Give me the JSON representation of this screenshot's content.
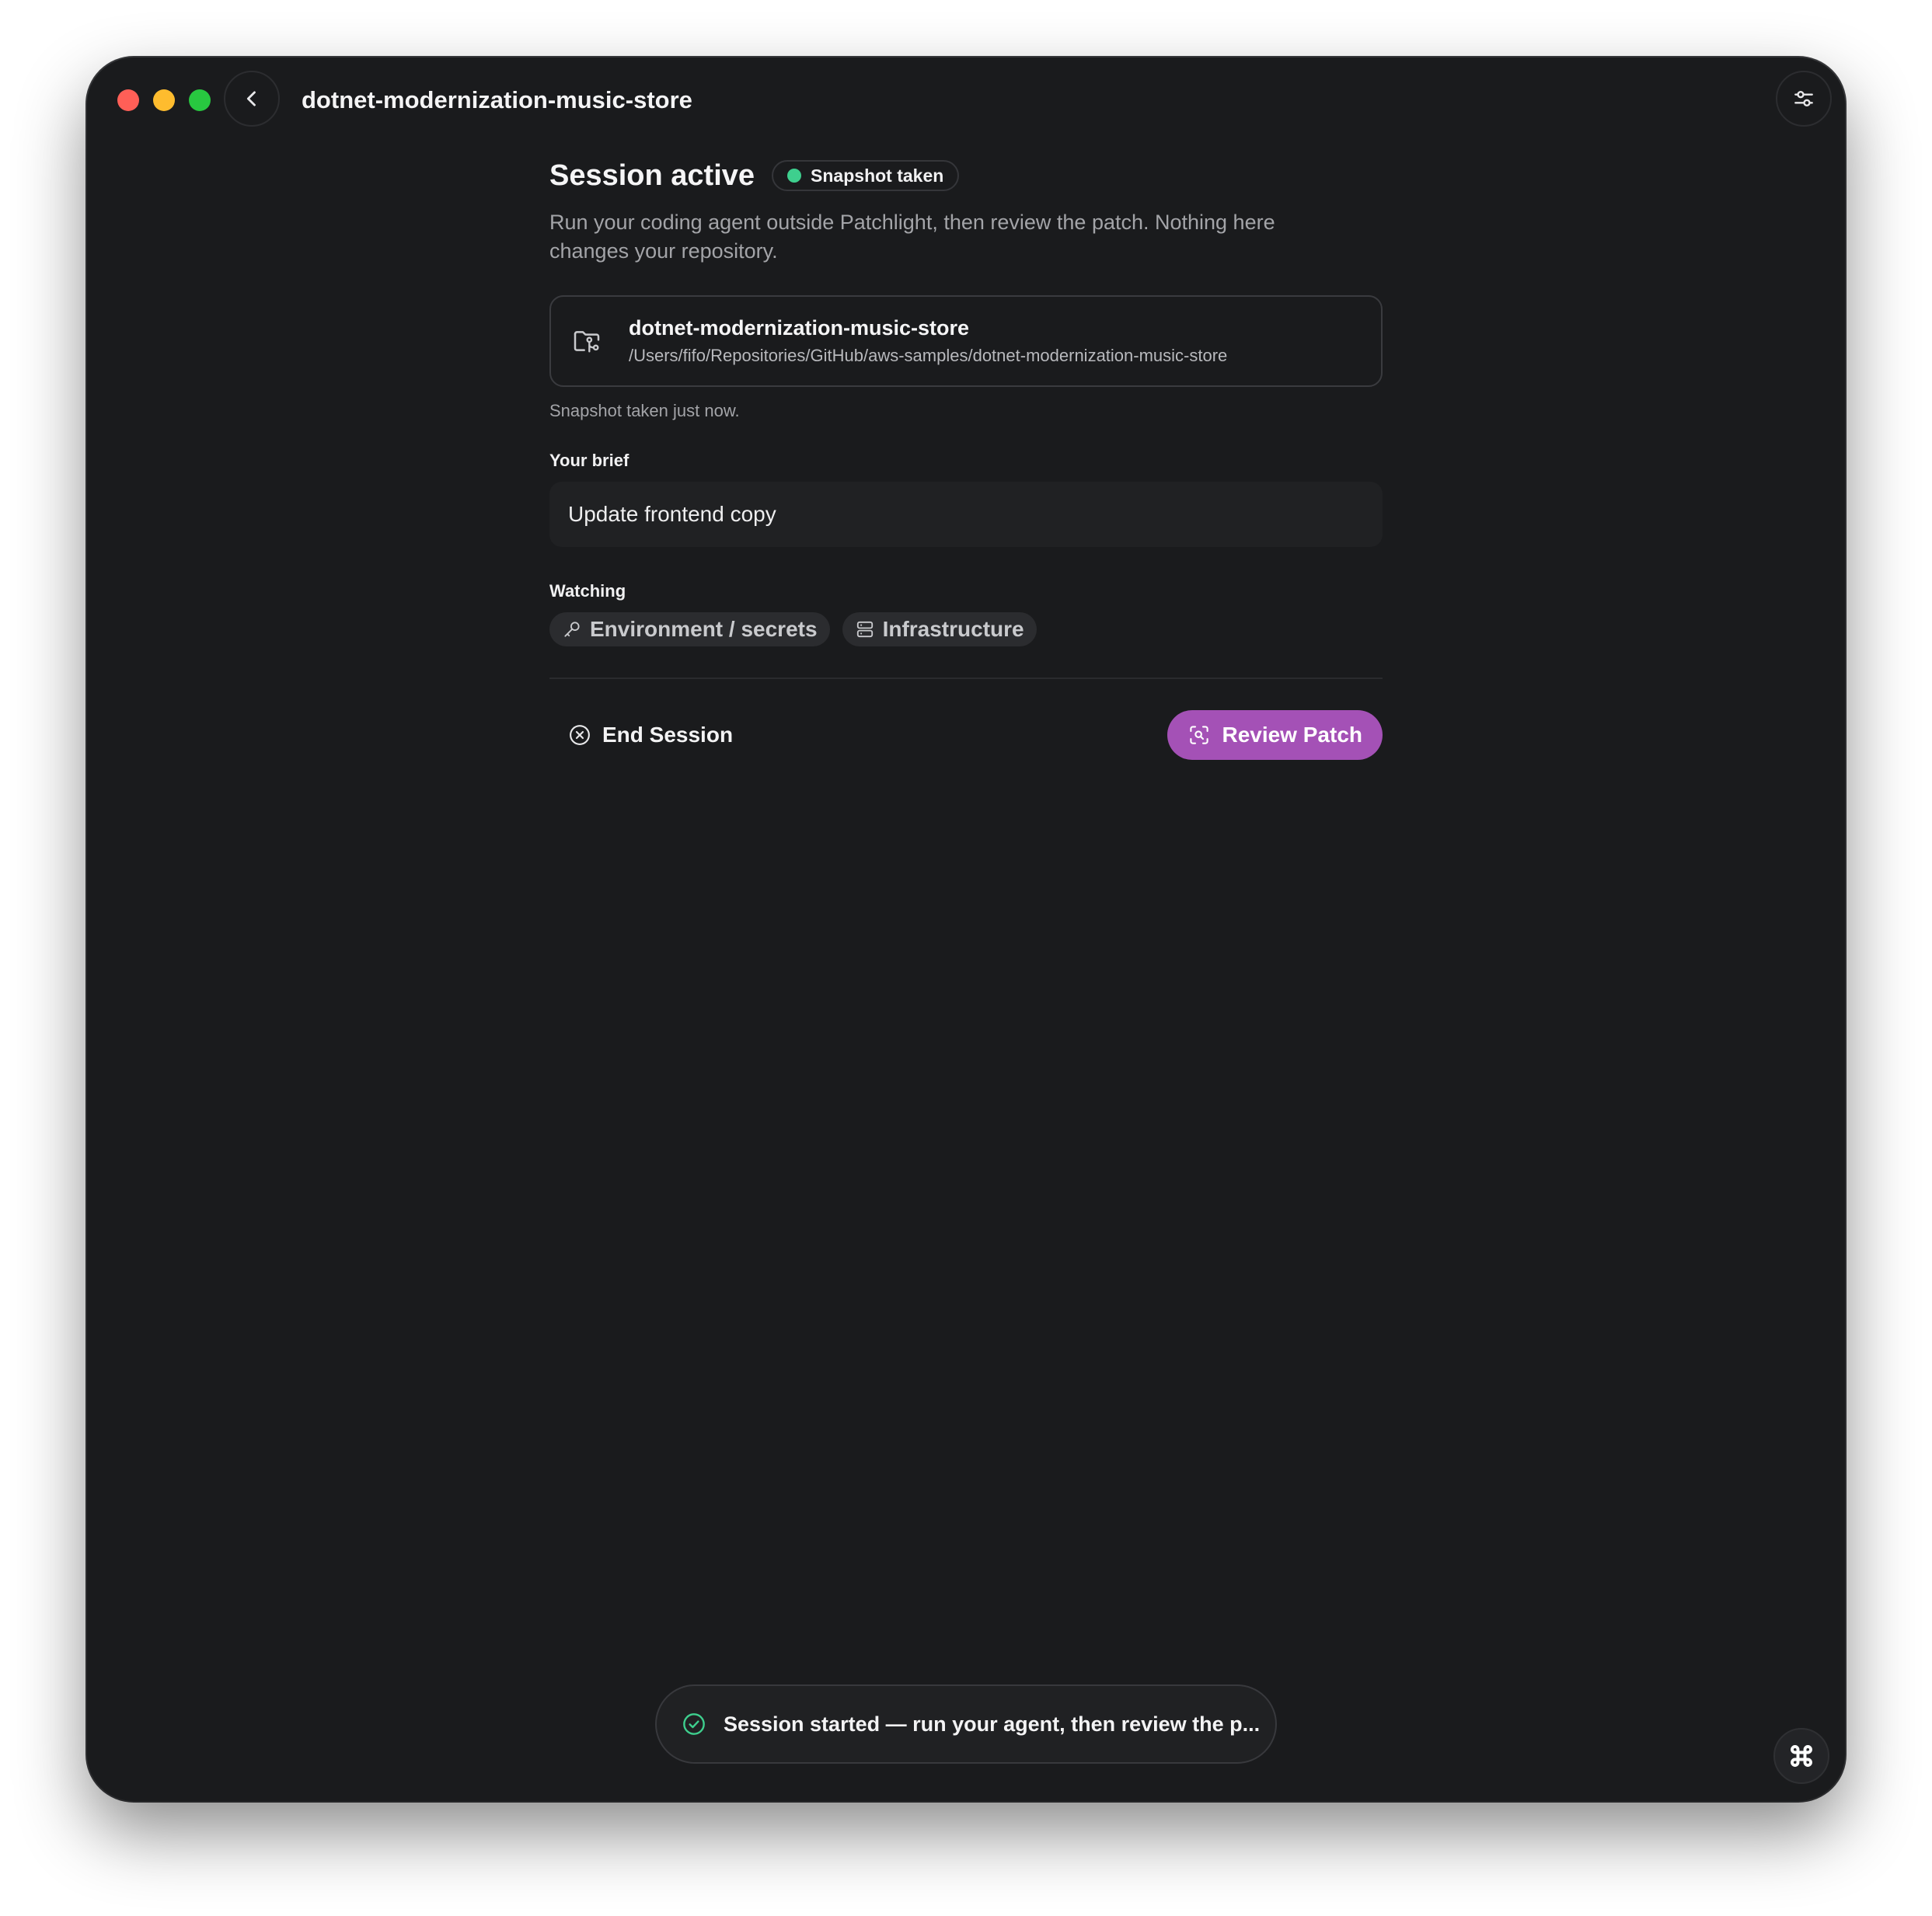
{
  "window": {
    "title": "dotnet-modernization-music-store"
  },
  "header": {
    "title": "Session active",
    "badge": "Snapshot taken"
  },
  "description": "Run your coding agent outside Patchlight, then review the patch. Nothing here changes your repository.",
  "repo": {
    "name": "dotnet-modernization-music-store",
    "path": "/Users/fifo/Repositories/GitHub/aws-samples/dotnet-modernization-music-store"
  },
  "snapshot_note": "Snapshot taken just now.",
  "brief": {
    "label": "Your brief",
    "value": "Update frontend copy"
  },
  "watching": {
    "label": "Watching",
    "chips": [
      {
        "label": "Environment / secrets",
        "icon": "key-icon"
      },
      {
        "label": "Infrastructure",
        "icon": "server-icon"
      }
    ]
  },
  "actions": {
    "end": "End Session",
    "review": "Review Patch"
  },
  "toast": {
    "message": "Session started — run your agent, then review the p..."
  },
  "colors": {
    "accent": "#a451b6",
    "status": "#3ecf8e",
    "background": "#1a1b1d"
  }
}
